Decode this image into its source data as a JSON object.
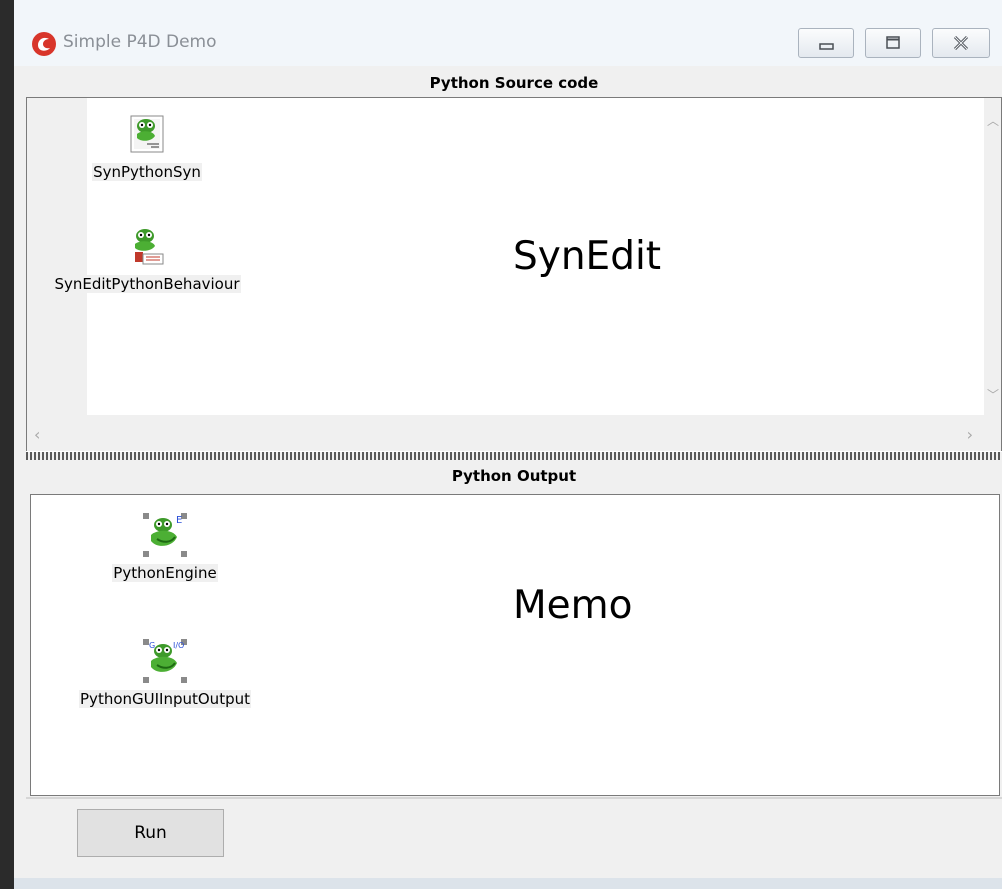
{
  "window": {
    "title": "Simple P4D Demo",
    "controls": {
      "minimize_icon": "minimize-icon",
      "maximize_icon": "maximize-icon",
      "close_icon": "close-icon"
    }
  },
  "source_panel": {
    "title": "Python Source code",
    "editor_label": "SynEdit",
    "components": [
      {
        "label": "SynPythonSyn",
        "icon": "python-syntax-icon"
      },
      {
        "label": "SynEditPythonBehaviour",
        "icon": "python-behaviour-icon"
      }
    ]
  },
  "output_panel": {
    "title": "Python Output",
    "memo_label": "Memo",
    "components": [
      {
        "label": "PythonEngine",
        "icon": "python-engine-icon"
      },
      {
        "label": "PythonGUIInputOutput",
        "icon": "python-gui-io-icon"
      }
    ]
  },
  "actions": {
    "run_label": "Run"
  }
}
